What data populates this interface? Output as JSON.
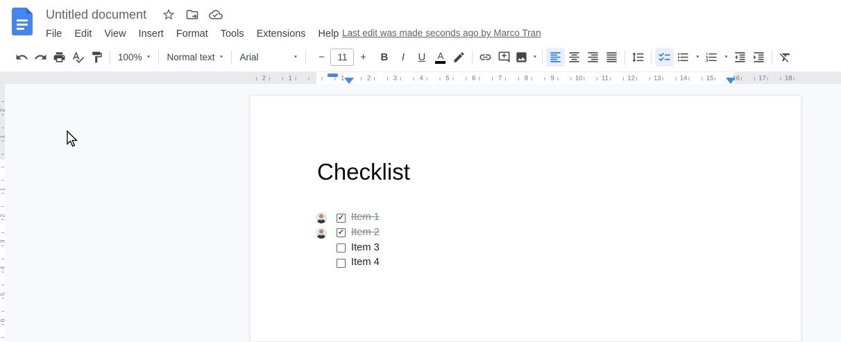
{
  "header": {
    "app_icon": "google-docs",
    "doc_title": "Untitled document",
    "menu_items": [
      "File",
      "Edit",
      "View",
      "Insert",
      "Format",
      "Tools",
      "Extensions",
      "Help"
    ],
    "last_edit_status": "Last edit was made seconds ago by Marco Tran"
  },
  "toolbar": {
    "zoom_value": "100%",
    "paragraph_style": "Normal text",
    "font_family": "Arial",
    "font_size": "11",
    "decrease_font_label": "−",
    "increase_font_label": "+",
    "bold_label": "B",
    "italic_label": "I",
    "underline_label": "U",
    "text_color_label": "A"
  },
  "glyphs": {
    "caret": "▼",
    "check": "✓"
  },
  "ruler": {
    "unit": "cm",
    "horizontal_margin_numbers": [
      "2",
      "1"
    ],
    "horizontal_numbers": [
      "1",
      "2",
      "3",
      "4",
      "5",
      "6",
      "7",
      "8",
      "9",
      "10",
      "11",
      "12",
      "13",
      "14",
      "15",
      "16",
      "17",
      "18"
    ],
    "vertical_margin_numbers": [
      "2",
      "1"
    ],
    "vertical_numbers": [
      "1",
      "2",
      "3",
      "4",
      "5",
      "6"
    ]
  },
  "document": {
    "title": "Checklist",
    "checklist": [
      {
        "label": "Item 1",
        "checked": true,
        "assignee_avatar": true
      },
      {
        "label": "Item 2",
        "checked": true,
        "assignee_avatar": true
      },
      {
        "label": "Item 3",
        "checked": false,
        "assignee_avatar": false
      },
      {
        "label": "Item 4",
        "checked": false,
        "assignee_avatar": false
      }
    ]
  },
  "colors": {
    "accent": "#1a73e8",
    "active_button_bg": "#e8f0fe",
    "canvas_bg": "#f8f9fa",
    "toolbar_icon": "#444746",
    "completed_item_text": "#80868b",
    "docs_logo_blue": "#4285f4",
    "ruler_marker_blue": "#4285f4"
  }
}
